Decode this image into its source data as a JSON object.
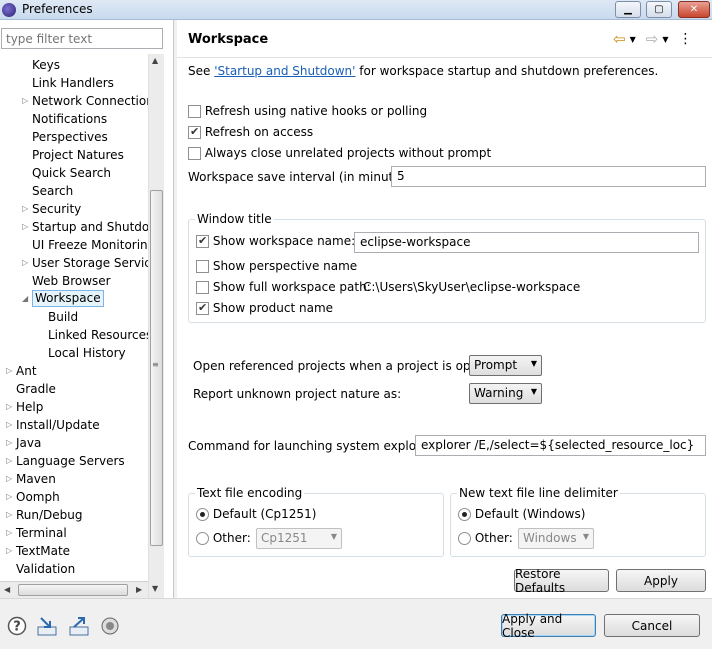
{
  "window": {
    "title": "Preferences"
  },
  "filter": {
    "placeholder": "type filter text"
  },
  "tree": {
    "items": [
      {
        "label": "Keys",
        "indent": 1,
        "arrow": false
      },
      {
        "label": "Link Handlers",
        "indent": 1,
        "arrow": false
      },
      {
        "label": "Network Connections",
        "indent": 1,
        "arrow": true
      },
      {
        "label": "Notifications",
        "indent": 1,
        "arrow": false
      },
      {
        "label": "Perspectives",
        "indent": 1,
        "arrow": false
      },
      {
        "label": "Project Natures",
        "indent": 1,
        "arrow": false
      },
      {
        "label": "Quick Search",
        "indent": 1,
        "arrow": false
      },
      {
        "label": "Search",
        "indent": 1,
        "arrow": false
      },
      {
        "label": "Security",
        "indent": 1,
        "arrow": true
      },
      {
        "label": "Startup and Shutdown",
        "indent": 1,
        "arrow": true
      },
      {
        "label": "UI Freeze Monitoring",
        "indent": 1,
        "arrow": false
      },
      {
        "label": "User Storage Service",
        "indent": 1,
        "arrow": true
      },
      {
        "label": "Web Browser",
        "indent": 1,
        "arrow": false
      },
      {
        "label": "Workspace",
        "indent": 1,
        "arrow": "open",
        "selected": true
      },
      {
        "label": "Build",
        "indent": 2,
        "arrow": false
      },
      {
        "label": "Linked Resources",
        "indent": 2,
        "arrow": false
      },
      {
        "label": "Local History",
        "indent": 2,
        "arrow": false
      },
      {
        "label": "Ant",
        "indent": 0,
        "arrow": true
      },
      {
        "label": "Gradle",
        "indent": 0,
        "arrow": false
      },
      {
        "label": "Help",
        "indent": 0,
        "arrow": true
      },
      {
        "label": "Install/Update",
        "indent": 0,
        "arrow": true
      },
      {
        "label": "Java",
        "indent": 0,
        "arrow": true
      },
      {
        "label": "Language Servers",
        "indent": 0,
        "arrow": true
      },
      {
        "label": "Maven",
        "indent": 0,
        "arrow": true
      },
      {
        "label": "Oomph",
        "indent": 0,
        "arrow": true
      },
      {
        "label": "Run/Debug",
        "indent": 0,
        "arrow": true
      },
      {
        "label": "Terminal",
        "indent": 0,
        "arrow": true
      },
      {
        "label": "TextMate",
        "indent": 0,
        "arrow": true
      },
      {
        "label": "Validation",
        "indent": 0,
        "arrow": false
      }
    ]
  },
  "page": {
    "title": "Workspace",
    "intro_prefix": "See ",
    "intro_link": "'Startup and Shutdown'",
    "intro_suffix": " for workspace startup and shutdown preferences.",
    "refresh_native": "Refresh using native hooks or polling",
    "refresh_access": "Refresh on access",
    "always_close": "Always close unrelated projects without prompt",
    "save_interval_label": "Workspace save interval (in minutes):",
    "save_interval_value": "5",
    "window_title_group": "Window title",
    "show_workspace_name": "Show workspace name:",
    "workspace_name_value": "eclipse-workspace",
    "show_perspective_name": "Show perspective name",
    "show_full_path": "Show full workspace path:",
    "full_path_value": "C:\\Users\\SkyUser\\eclipse-workspace",
    "show_product_name": "Show product name",
    "open_ref_label": "Open referenced projects when a project is opened:",
    "open_ref_value": "Prompt",
    "report_unknown_label": "Report unknown project nature as:",
    "report_unknown_value": "Warning",
    "command_label": "Command for launching system explorer:",
    "command_value": "explorer /E,/select=${selected_resource_loc}",
    "encoding_group": "Text file encoding",
    "encoding_default": "Default (Cp1251)",
    "encoding_other": "Other:",
    "encoding_other_value": "Cp1251",
    "delimiter_group": "New text file line delimiter",
    "delimiter_default": "Default (Windows)",
    "delimiter_other": "Other:",
    "delimiter_other_value": "Windows",
    "restore_defaults": "Restore Defaults",
    "apply": "Apply"
  },
  "footer": {
    "apply_close": "Apply and Close",
    "cancel": "Cancel"
  }
}
